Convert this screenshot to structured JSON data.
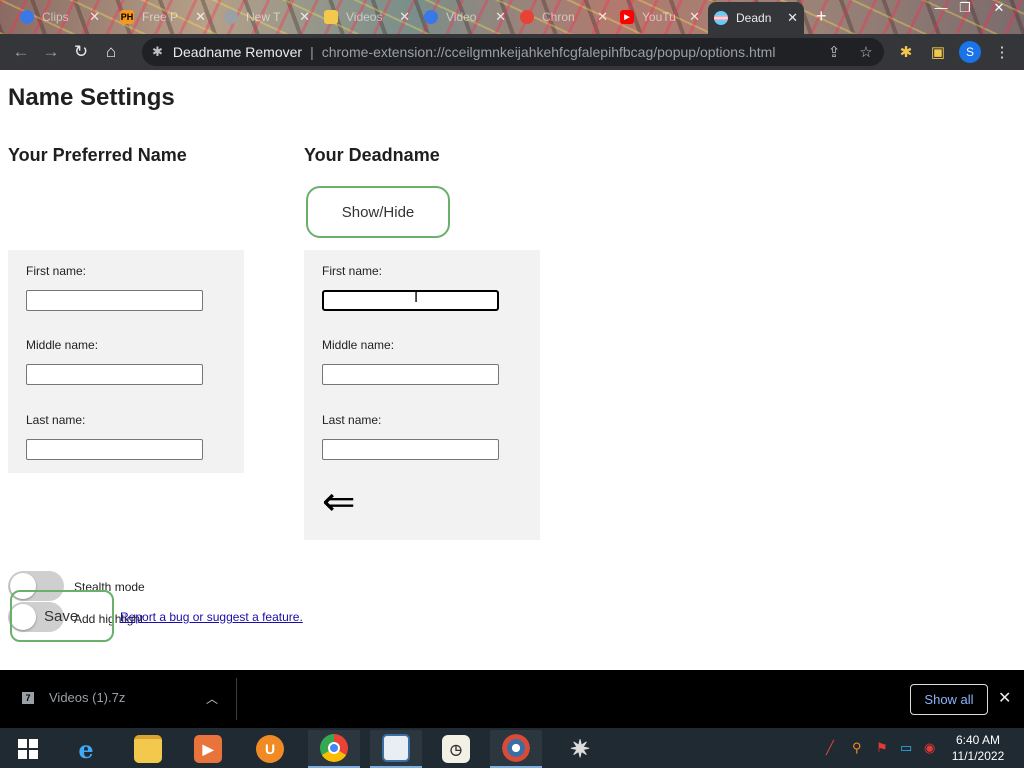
{
  "browser": {
    "tabs": [
      {
        "label": "Clips",
        "favicon": "clipchamp-icon",
        "color": "#3b78e7"
      },
      {
        "label": "Free P",
        "favicon": "ph-icon",
        "color": "#f7971e"
      },
      {
        "label": "New T",
        "favicon": "chrome-icon",
        "color": "#9aa0a6"
      },
      {
        "label": "Videos",
        "favicon": "folder-icon",
        "color": "#f2c94c"
      },
      {
        "label": "Video",
        "favicon": "clipchamp-icon",
        "color": "#3b78e7"
      },
      {
        "label": "Chron",
        "favicon": "chrome-webstore-icon",
        "color": "#e94235"
      },
      {
        "label": "YouTu",
        "favicon": "youtube-icon",
        "color": "#ff0000"
      },
      {
        "label": "Deadn",
        "favicon": "trans-flag-icon",
        "color": "#5bcefa",
        "active": true
      }
    ],
    "address": {
      "origin": "Deadname Remover",
      "url": "chrome-extension://cceilgmnkeijahkehfcgfalepihfbcag/popup/options.html"
    },
    "profile_initial": "S"
  },
  "page": {
    "title": "Name Settings",
    "preferred": {
      "heading": "Your Preferred Name",
      "first_label": "First name:",
      "middle_label": "Middle name:",
      "last_label": "Last name:",
      "first_value": "",
      "middle_value": "",
      "last_value": ""
    },
    "deadname": {
      "heading": "Your Deadname",
      "show_hide": "Show/Hide",
      "first_label": "First name:",
      "middle_label": "Middle name:",
      "last_label": "Last name:",
      "first_value": "",
      "middle_value": "",
      "last_value": "",
      "add_row_arrow": "⇐"
    },
    "stealth_label": "Stealth mode",
    "highlight_label": "Add highlight",
    "save_label": "Save",
    "bug_link": "Report a bug or suggest a feature."
  },
  "downloads": {
    "file": "Videos (1).7z",
    "show_all": "Show all"
  },
  "taskbar": {
    "time": "6:40 AM",
    "date": "11/1/2022"
  },
  "colors": {
    "accent_green": "#6ab06a",
    "panel_bg": "#f2f2f2",
    "link": "#1a0dab"
  }
}
